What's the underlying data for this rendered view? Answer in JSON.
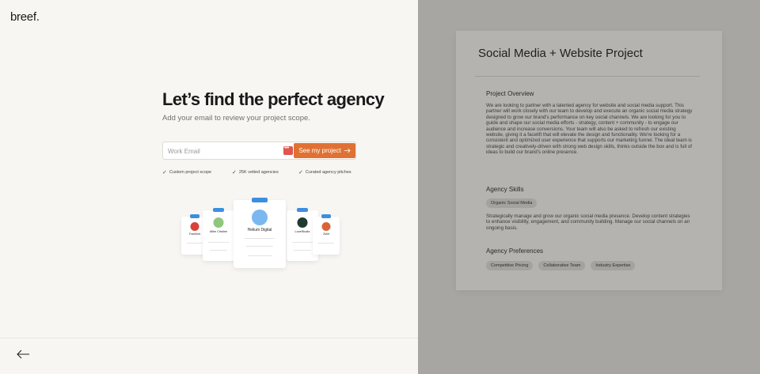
{
  "brand": {
    "logo": "breef."
  },
  "hero": {
    "headline": "Let’s find the perfect agency",
    "subhead": "Add your email to review your project scope."
  },
  "email_form": {
    "placeholder": "Work Email",
    "value": "",
    "submit_label": "See my project",
    "submit_icon": "arrow-right-icon"
  },
  "features": [
    {
      "label": "Custom project scope",
      "icon": "check-icon"
    },
    {
      "label": "25K vetted agencies",
      "icon": "check-icon"
    },
    {
      "label": "Curated agency pitches",
      "icon": "check-icon"
    }
  ],
  "cards": {
    "featured_name": "Helium Digital",
    "left_name": "Mike Cristine",
    "right_name": "LoveStudio",
    "far_left_name": "Frankfurt",
    "far_right_name": "Zubit"
  },
  "nav": {
    "back_icon": "arrow-left-icon"
  },
  "scope": {
    "title": "Social Media + Website Project",
    "overview_title": "Project Overview",
    "overview_text": "We are looking to partner with a talented agency for website and social media support. This partner will work closely with our team to develop and execute an organic social media strategy designed to grow our brand's performance on key social channels. We are looking for you to guide and shape our social media efforts - strategy, content + community - to engage our audience and increase conversions. Your team will also be asked to refresh our existing website, giving it a facelift that will elevate the design and functionality. We're looking for a consistent and optimized user experience that supports our marketing funnel. The ideal team is strategic and creatively-driven with strong web design skills, thinks outside the box and is full of ideas to build our brand's online presence.",
    "skills_title": "Agency Skills",
    "skills": [
      "Organic Social Media"
    ],
    "skills_text": "Strategically manage and grow our organic social media presence. Develop content strategies to enhance visibility, engagement, and community building. Manage our social channels on an ongoing basis.",
    "prefs_title": "Agency Preferences",
    "preferences": [
      "Competitive Pricing",
      "Collaborative Team",
      "Industry Expertise"
    ]
  },
  "colors": {
    "accent": "#e07133",
    "background": "#f8f6f2",
    "overlay": "#a7a6a3",
    "card_tag": "#3b8fe0"
  }
}
